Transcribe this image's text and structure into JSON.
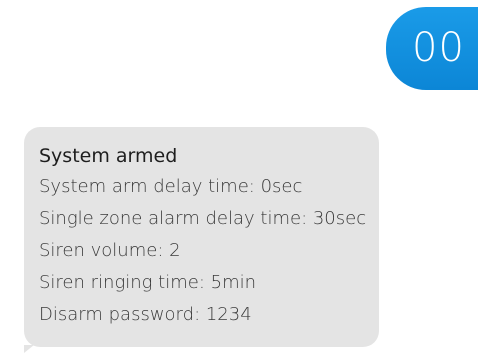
{
  "outgoing": {
    "text": "00"
  },
  "incoming": {
    "title": "System armed",
    "lines": [
      "System arm delay time: 0sec",
      "Single zone alarm delay time: 30sec",
      "Siren volume: 2",
      "Siren ringing time: 5min",
      "Disarm password: 1234"
    ]
  },
  "colors": {
    "outgoing_bubble": "#1190df",
    "incoming_bubble": "#e4e4e4",
    "text": "#1e1e1e"
  }
}
